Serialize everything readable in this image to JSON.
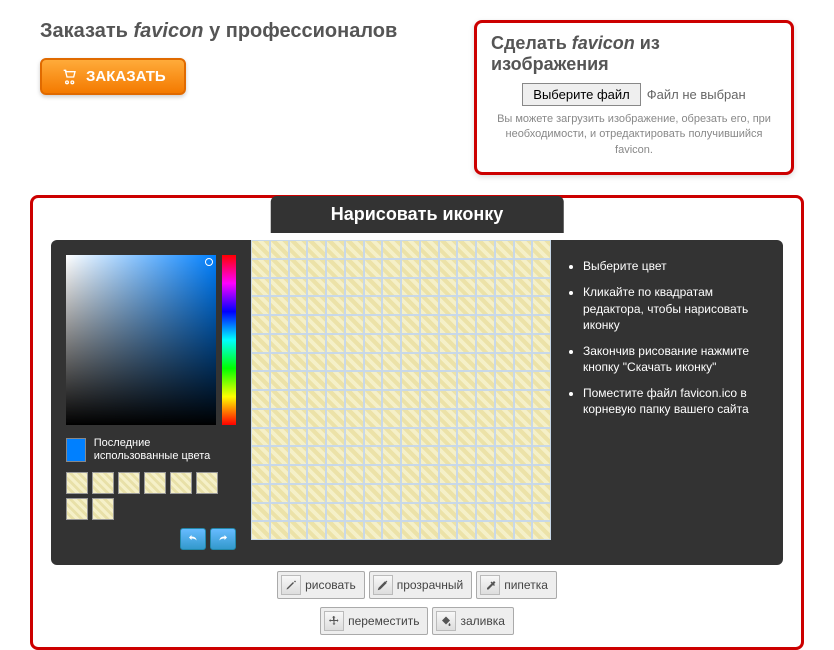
{
  "order": {
    "title_pre": "Заказать ",
    "title_word": "favicon",
    "title_post": " у профессионалов",
    "button": "ЗАКАЗАТЬ"
  },
  "upload": {
    "title_pre": "Сделать ",
    "title_word": "favicon",
    "title_post": " из изображения",
    "choose_btn": "Выберите файл",
    "status": "Файл не выбран",
    "help": "Вы можете загрузить изображение, обрезать его, при необходимости, и отредактировать получившийся favicon."
  },
  "editor": {
    "title": "Нарисовать иконку",
    "recent_label": "Последние использованные цвета",
    "instructions": [
      "Выберите цвет",
      "Кликайте по квадратам редактора, чтобы нарисовать иконку",
      "Закончив рисование нажмите кнопку \"Скачать иконку\"",
      "Поместите файл favicon.ico в корневую папку вашего сайта"
    ],
    "tools": {
      "draw": "рисовать",
      "transparent": "прозрачный",
      "eyedropper": "пипетка",
      "move": "переместить",
      "fill": "заливка"
    }
  },
  "colors": {
    "current": "#0080ff"
  }
}
